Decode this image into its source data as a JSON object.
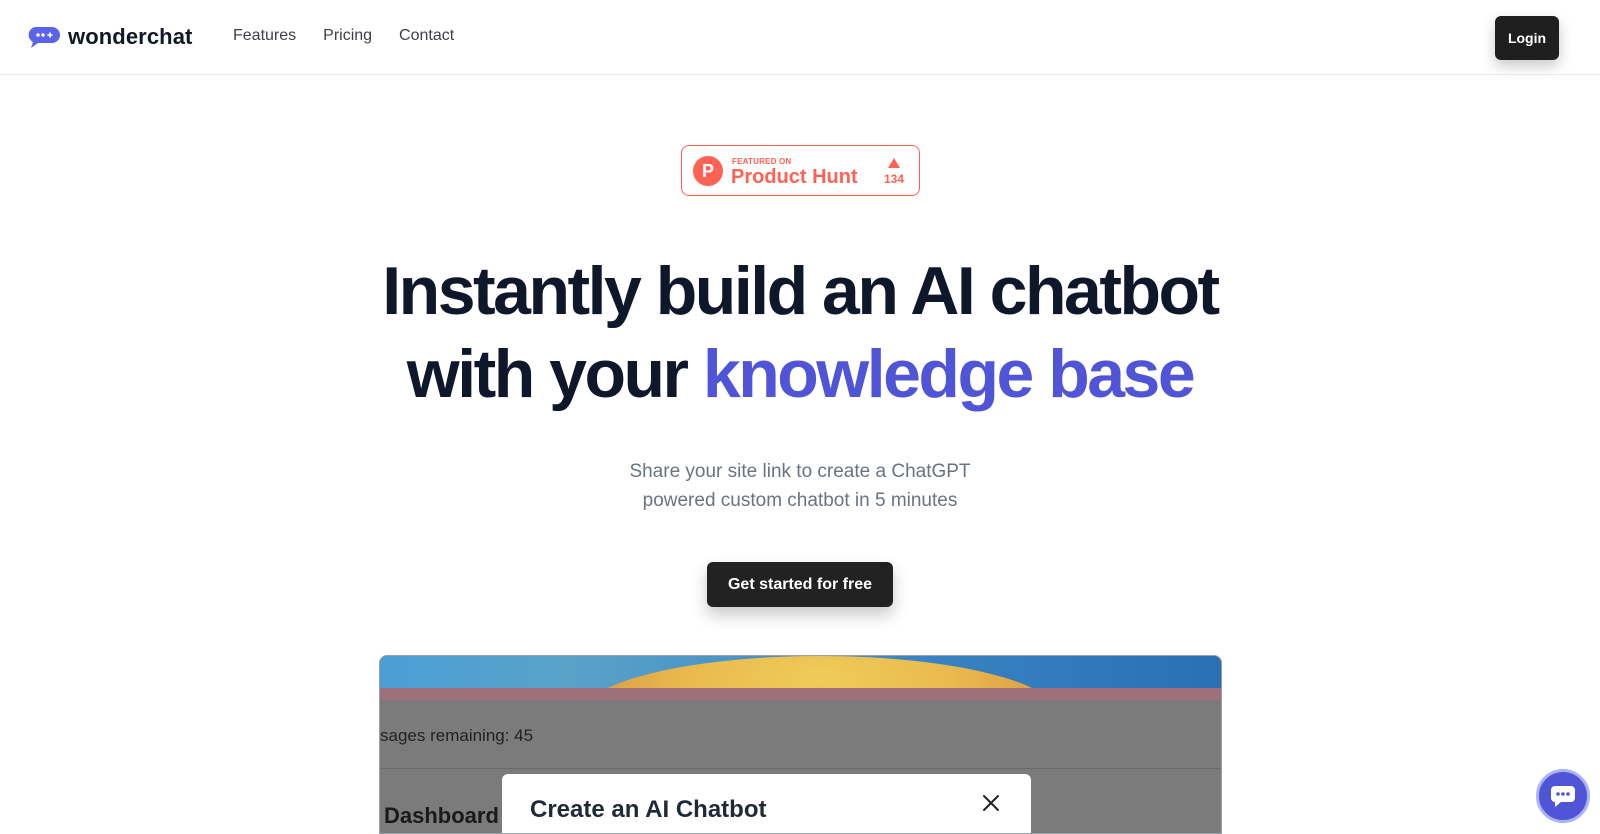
{
  "header": {
    "brand": "wonderchat",
    "nav": [
      {
        "label": "Features"
      },
      {
        "label": "Pricing"
      },
      {
        "label": "Contact"
      }
    ],
    "login_label": "Login"
  },
  "badge": {
    "featured_label": "FEATURED ON",
    "name": "Product Hunt",
    "logo_letter": "P",
    "upvotes": "134"
  },
  "hero": {
    "title_line1": "Instantly build an AI chatbot",
    "title_line2_prefix": "with your ",
    "title_line2_accent": "knowledge base",
    "subtitle_line1": "Share your site link to create a ChatGPT",
    "subtitle_line2": "powered custom chatbot in 5 minutes",
    "cta_label": "Get started for free"
  },
  "preview": {
    "messages_remaining": "sages remaining: 45",
    "dashboard_label": "Dashboard",
    "modal_title": "Create an AI Chatbot"
  },
  "colors": {
    "accent": "#4f55d6",
    "product_hunt": "#ff6154",
    "dark_button": "#1f1f1f"
  },
  "icons": {
    "logo": "chat-bubble-icon",
    "modal_close": "close-icon",
    "chat_widget": "chat-bubble-icon"
  }
}
